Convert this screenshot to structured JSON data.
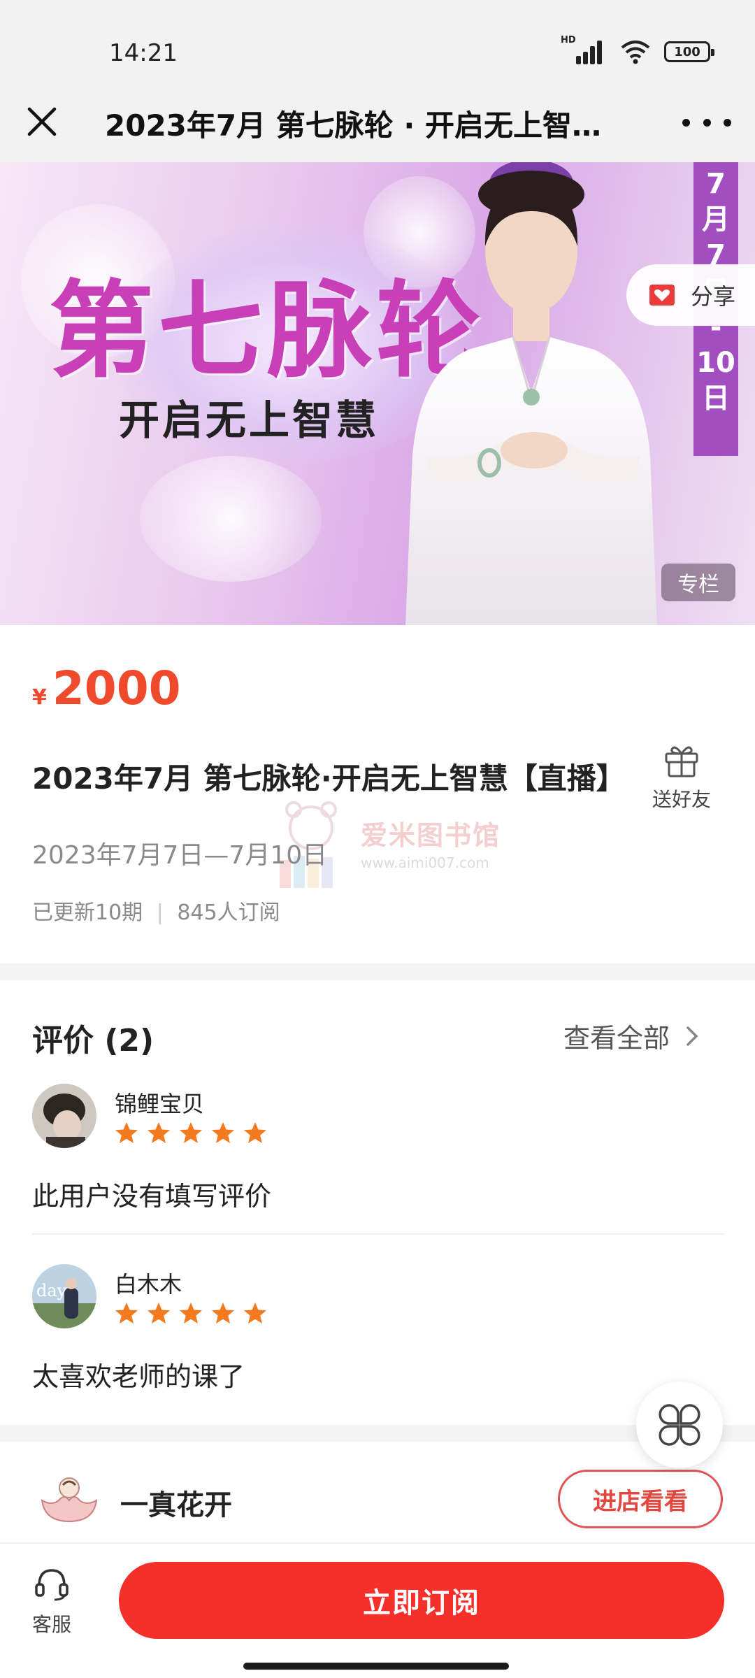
{
  "status_bar": {
    "time": "14:21",
    "network_badge": "HD",
    "battery": "100"
  },
  "nav": {
    "title": "2023年7月 第七脉轮 · 开启无上智慧【直播】"
  },
  "banner": {
    "title_main": "第七脉轮",
    "title_sub": "开启无上智慧",
    "date_ribbon": [
      "7",
      "月",
      "7",
      "日",
      "-",
      "10",
      "日"
    ],
    "share_label": "分享",
    "column_tag": "专栏"
  },
  "product": {
    "currency": "¥",
    "price": "2000",
    "title": "2023年7月 第七脉轮·开启无上智慧【直播】",
    "gift_label": "送好友",
    "date_range": "2023年7月7日—7月10日",
    "updates": "已更新10期",
    "subscribers": "845人订阅",
    "watermark_text": "爱米图书馆",
    "watermark_url": "www.aimi007.com"
  },
  "reviews": {
    "header": "评价 (2)",
    "view_all": "查看全部",
    "items": [
      {
        "name": "锦鲤宝贝",
        "rating": 5,
        "text": "此用户没有填写评价"
      },
      {
        "name": "白木木",
        "rating": 5,
        "text": "太喜欢老师的课了"
      }
    ]
  },
  "shop": {
    "name": "一真花开",
    "enter_label": "进店看看"
  },
  "bottom": {
    "service_label": "客服",
    "subscribe_label": "立即订阅"
  },
  "colors": {
    "accent": "#f52f29",
    "price": "#ee4a2b",
    "star": "#f47a1f"
  }
}
